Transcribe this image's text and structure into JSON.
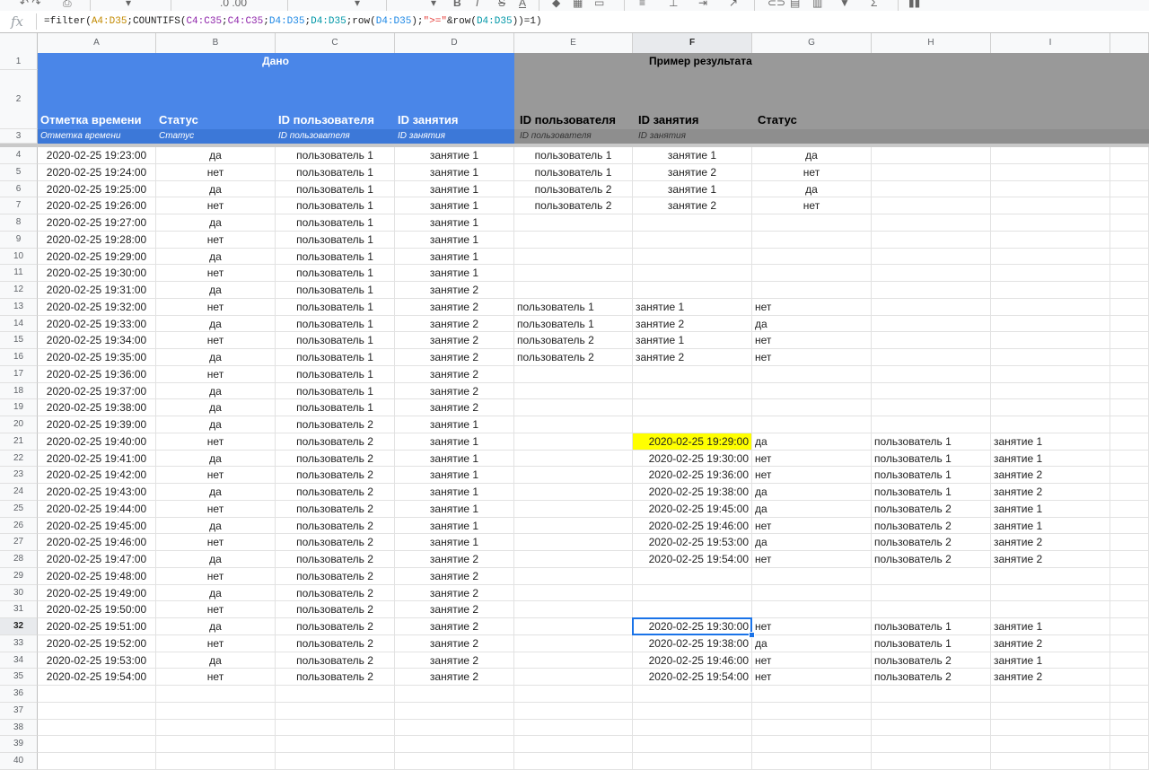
{
  "formula_bar": {
    "fx_label": "fx",
    "formula_parts": [
      {
        "t": "=filter(",
        "c": ""
      },
      {
        "t": "A4:D35",
        "c": "r1"
      },
      {
        "t": ";COUNTIFS(",
        "c": ""
      },
      {
        "t": "C4:C35",
        "c": "r2"
      },
      {
        "t": ";",
        "c": ""
      },
      {
        "t": "C4:C35",
        "c": "r2"
      },
      {
        "t": ";",
        "c": ""
      },
      {
        "t": "D4:D35",
        "c": "r3"
      },
      {
        "t": ";",
        "c": ""
      },
      {
        "t": "D4:D35",
        "c": "r4"
      },
      {
        "t": ";row(",
        "c": ""
      },
      {
        "t": "D4:D35",
        "c": "r3"
      },
      {
        "t": ");",
        "c": ""
      },
      {
        "t": "\">=\"",
        "c": "r5"
      },
      {
        "t": "&row(",
        "c": ""
      },
      {
        "t": "D4:D35",
        "c": "r4"
      },
      {
        "t": "))=1)",
        "c": ""
      }
    ]
  },
  "columns": [
    "A",
    "B",
    "C",
    "D",
    "E",
    "F",
    "G",
    "H",
    "I"
  ],
  "selected_column": "F",
  "selected_row": 32,
  "header": {
    "given_label": "Дано",
    "result_label": "Пример результата",
    "row2": [
      "Отметка времени",
      "Статус",
      "ID пользователя",
      "ID занятия",
      "ID пользователя",
      "ID занятия",
      "Статус"
    ],
    "row3": [
      "Отметка времени",
      "Статус",
      "ID пользователя",
      "ID занятия",
      "ID пользователя",
      "ID занятия"
    ]
  },
  "source_rows": [
    [
      "2020-02-25 19:23:00",
      "да",
      "пользователь 1",
      "занятие 1"
    ],
    [
      "2020-02-25 19:24:00",
      "нет",
      "пользователь 1",
      "занятие 1"
    ],
    [
      "2020-02-25 19:25:00",
      "да",
      "пользователь 1",
      "занятие 1"
    ],
    [
      "2020-02-25 19:26:00",
      "нет",
      "пользователь 1",
      "занятие 1"
    ],
    [
      "2020-02-25 19:27:00",
      "да",
      "пользователь 1",
      "занятие 1"
    ],
    [
      "2020-02-25 19:28:00",
      "нет",
      "пользователь 1",
      "занятие 1"
    ],
    [
      "2020-02-25 19:29:00",
      "да",
      "пользователь 1",
      "занятие 1"
    ],
    [
      "2020-02-25 19:30:00",
      "нет",
      "пользователь 1",
      "занятие 1"
    ],
    [
      "2020-02-25 19:31:00",
      "да",
      "пользователь 1",
      "занятие 2"
    ],
    [
      "2020-02-25 19:32:00",
      "нет",
      "пользователь 1",
      "занятие 2"
    ],
    [
      "2020-02-25 19:33:00",
      "да",
      "пользователь 1",
      "занятие 2"
    ],
    [
      "2020-02-25 19:34:00",
      "нет",
      "пользователь 1",
      "занятие 2"
    ],
    [
      "2020-02-25 19:35:00",
      "да",
      "пользователь 1",
      "занятие 2"
    ],
    [
      "2020-02-25 19:36:00",
      "нет",
      "пользователь 1",
      "занятие 2"
    ],
    [
      "2020-02-25 19:37:00",
      "да",
      "пользователь 1",
      "занятие 2"
    ],
    [
      "2020-02-25 19:38:00",
      "да",
      "пользователь 1",
      "занятие 2"
    ],
    [
      "2020-02-25 19:39:00",
      "да",
      "пользователь 2",
      "занятие 1"
    ],
    [
      "2020-02-25 19:40:00",
      "нет",
      "пользователь 2",
      "занятие 1"
    ],
    [
      "2020-02-25 19:41:00",
      "да",
      "пользователь 2",
      "занятие 1"
    ],
    [
      "2020-02-25 19:42:00",
      "нет",
      "пользователь 2",
      "занятие 1"
    ],
    [
      "2020-02-25 19:43:00",
      "да",
      "пользователь 2",
      "занятие 1"
    ],
    [
      "2020-02-25 19:44:00",
      "нет",
      "пользователь 2",
      "занятие 1"
    ],
    [
      "2020-02-25 19:45:00",
      "да",
      "пользователь 2",
      "занятие 1"
    ],
    [
      "2020-02-25 19:46:00",
      "нет",
      "пользователь 2",
      "занятие 1"
    ],
    [
      "2020-02-25 19:47:00",
      "да",
      "пользователь 2",
      "занятие 2"
    ],
    [
      "2020-02-25 19:48:00",
      "нет",
      "пользователь 2",
      "занятие 2"
    ],
    [
      "2020-02-25 19:49:00",
      "да",
      "пользователь 2",
      "занятие 2"
    ],
    [
      "2020-02-25 19:50:00",
      "нет",
      "пользователь 2",
      "занятие 2"
    ],
    [
      "2020-02-25 19:51:00",
      "да",
      "пользователь 2",
      "занятие 2"
    ],
    [
      "2020-02-25 19:52:00",
      "нет",
      "пользователь 2",
      "занятие 2"
    ],
    [
      "2020-02-25 19:53:00",
      "да",
      "пользователь 2",
      "занятие 2"
    ],
    [
      "2020-02-25 19:54:00",
      "нет",
      "пользователь 2",
      "занятие 2"
    ]
  ],
  "example_rows": [
    [
      "пользователь 1",
      "занятие 1",
      "да"
    ],
    [
      "пользователь 1",
      "занятие 2",
      "нет"
    ],
    [
      "пользователь 2",
      "занятие 1",
      "да"
    ],
    [
      "пользователь 2",
      "занятие 2",
      "нет"
    ]
  ],
  "left_results": [
    [
      "пользователь 1",
      "занятие 1",
      "нет"
    ],
    [
      "пользователь 1",
      "занятие 2",
      "да"
    ],
    [
      "пользователь 2",
      "занятие 1",
      "нет"
    ],
    [
      "пользователь 2",
      "занятие 2",
      "нет"
    ]
  ],
  "filter_results_1": [
    [
      "2020-02-25 19:29:00",
      "да",
      "пользователь 1",
      "занятие 1"
    ],
    [
      "2020-02-25 19:30:00",
      "нет",
      "пользователь 1",
      "занятие 1"
    ],
    [
      "2020-02-25 19:36:00",
      "нет",
      "пользователь 1",
      "занятие 2"
    ],
    [
      "2020-02-25 19:38:00",
      "да",
      "пользователь 1",
      "занятие 2"
    ],
    [
      "2020-02-25 19:45:00",
      "да",
      "пользователь 2",
      "занятие 1"
    ],
    [
      "2020-02-25 19:46:00",
      "нет",
      "пользователь 2",
      "занятие 1"
    ],
    [
      "2020-02-25 19:53:00",
      "да",
      "пользователь 2",
      "занятие 2"
    ],
    [
      "2020-02-25 19:54:00",
      "нет",
      "пользователь 2",
      "занятие 2"
    ]
  ],
  "filter_results_2": [
    [
      "2020-02-25 19:30:00",
      "нет",
      "пользователь 1",
      "занятие 1"
    ],
    [
      "2020-02-25 19:38:00",
      "да",
      "пользователь 1",
      "занятие 2"
    ],
    [
      "2020-02-25 19:46:00",
      "нет",
      "пользователь 2",
      "занятие 1"
    ],
    [
      "2020-02-25 19:54:00",
      "нет",
      "пользователь 2",
      "занятие 2"
    ]
  ],
  "highlight_color": "#ffff00",
  "given_color": "#4a86e8",
  "result_color": "#999999",
  "selection_color": "#1a73e8"
}
